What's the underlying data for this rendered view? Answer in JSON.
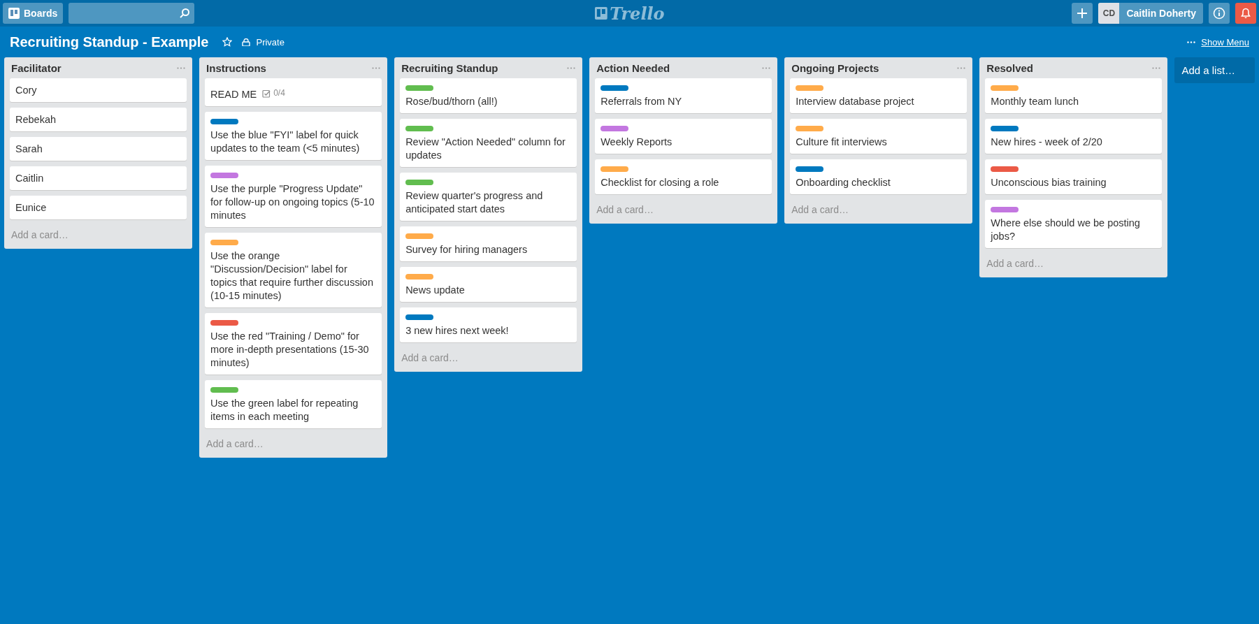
{
  "header": {
    "boards_button": "Boards",
    "logo": "Trello",
    "user": {
      "initials": "CD",
      "name": "Caitlin Doherty"
    }
  },
  "board": {
    "title": "Recruiting Standup - Example",
    "starred": false,
    "visibility": "Private",
    "show_menu": "Show Menu"
  },
  "lists": [
    {
      "title": "Facilitator",
      "add_card": "Add a card…",
      "cards": [
        {
          "title": "Cory"
        },
        {
          "title": "Rebekah"
        },
        {
          "title": "Sarah"
        },
        {
          "title": "Caitlin"
        },
        {
          "title": "Eunice"
        }
      ]
    },
    {
      "title": "Instructions",
      "add_card": "Add a card…",
      "cards": [
        {
          "title": "READ ME",
          "checklist": "0/4"
        },
        {
          "labels": [
            {
              "color": "#0079bf"
            }
          ],
          "title": "Use the blue \"FYI\" label for quick updates to the team (<5 minutes)"
        },
        {
          "labels": [
            {
              "color": "#c377e0"
            }
          ],
          "title": "Use the purple \"Progress Update\" for follow-up on ongoing topics (5-10 minutes"
        },
        {
          "labels": [
            {
              "color": "#ffab4a"
            }
          ],
          "title": "Use the orange \"Discussion/Decision\" label for topics that require further discussion (10-15 minutes)"
        },
        {
          "labels": [
            {
              "color": "#eb5a46"
            }
          ],
          "title": "Use the red \"Training / Demo\" for more in-depth presentations (15-30 minutes)"
        },
        {
          "labels": [
            {
              "color": "#61bd4f"
            }
          ],
          "title": "Use the green label for repeating items in each meeting"
        }
      ]
    },
    {
      "title": "Recruiting Standup",
      "add_card": "Add a card…",
      "cards": [
        {
          "labels": [
            {
              "color": "#61bd4f"
            }
          ],
          "title": "Rose/bud/thorn (all!)"
        },
        {
          "labels": [
            {
              "color": "#61bd4f"
            }
          ],
          "title": "Review \"Action Needed\" column for updates"
        },
        {
          "labels": [
            {
              "color": "#61bd4f"
            }
          ],
          "title": "Review quarter's progress and anticipated start dates"
        },
        {
          "labels": [
            {
              "color": "#ffab4a"
            }
          ],
          "title": "Survey for hiring managers"
        },
        {
          "labels": [
            {
              "color": "#ffab4a"
            }
          ],
          "title": "News update"
        },
        {
          "labels": [
            {
              "color": "#0079bf"
            }
          ],
          "title": "3 new hires next week!"
        }
      ]
    },
    {
      "title": "Action Needed",
      "add_card": "Add a card…",
      "cards": [
        {
          "labels": [
            {
              "color": "#0079bf"
            }
          ],
          "title": "Referrals from NY"
        },
        {
          "labels": [
            {
              "color": "#c377e0"
            }
          ],
          "title": "Weekly Reports"
        },
        {
          "labels": [
            {
              "color": "#ffab4a"
            }
          ],
          "title": "Checklist for closing a role"
        }
      ]
    },
    {
      "title": "Ongoing Projects",
      "add_card": "Add a card…",
      "cards": [
        {
          "labels": [
            {
              "color": "#ffab4a"
            }
          ],
          "title": "Interview database project"
        },
        {
          "labels": [
            {
              "color": "#ffab4a"
            }
          ],
          "title": "Culture fit interviews"
        },
        {
          "labels": [
            {
              "color": "#0079bf"
            }
          ],
          "title": "Onboarding checklist"
        }
      ]
    },
    {
      "title": "Resolved",
      "add_card": "Add a card…",
      "cards": [
        {
          "labels": [
            {
              "color": "#ffab4a"
            }
          ],
          "title": "Monthly team lunch"
        },
        {
          "labels": [
            {
              "color": "#0079bf"
            }
          ],
          "title": "New hires - week of 2/20"
        },
        {
          "labels": [
            {
              "color": "#eb5a46"
            }
          ],
          "title": "Unconscious bias training"
        },
        {
          "labels": [
            {
              "color": "#c377e0"
            }
          ],
          "title": "Where else should we be posting jobs?"
        }
      ]
    }
  ],
  "add_list": "Add a list…"
}
